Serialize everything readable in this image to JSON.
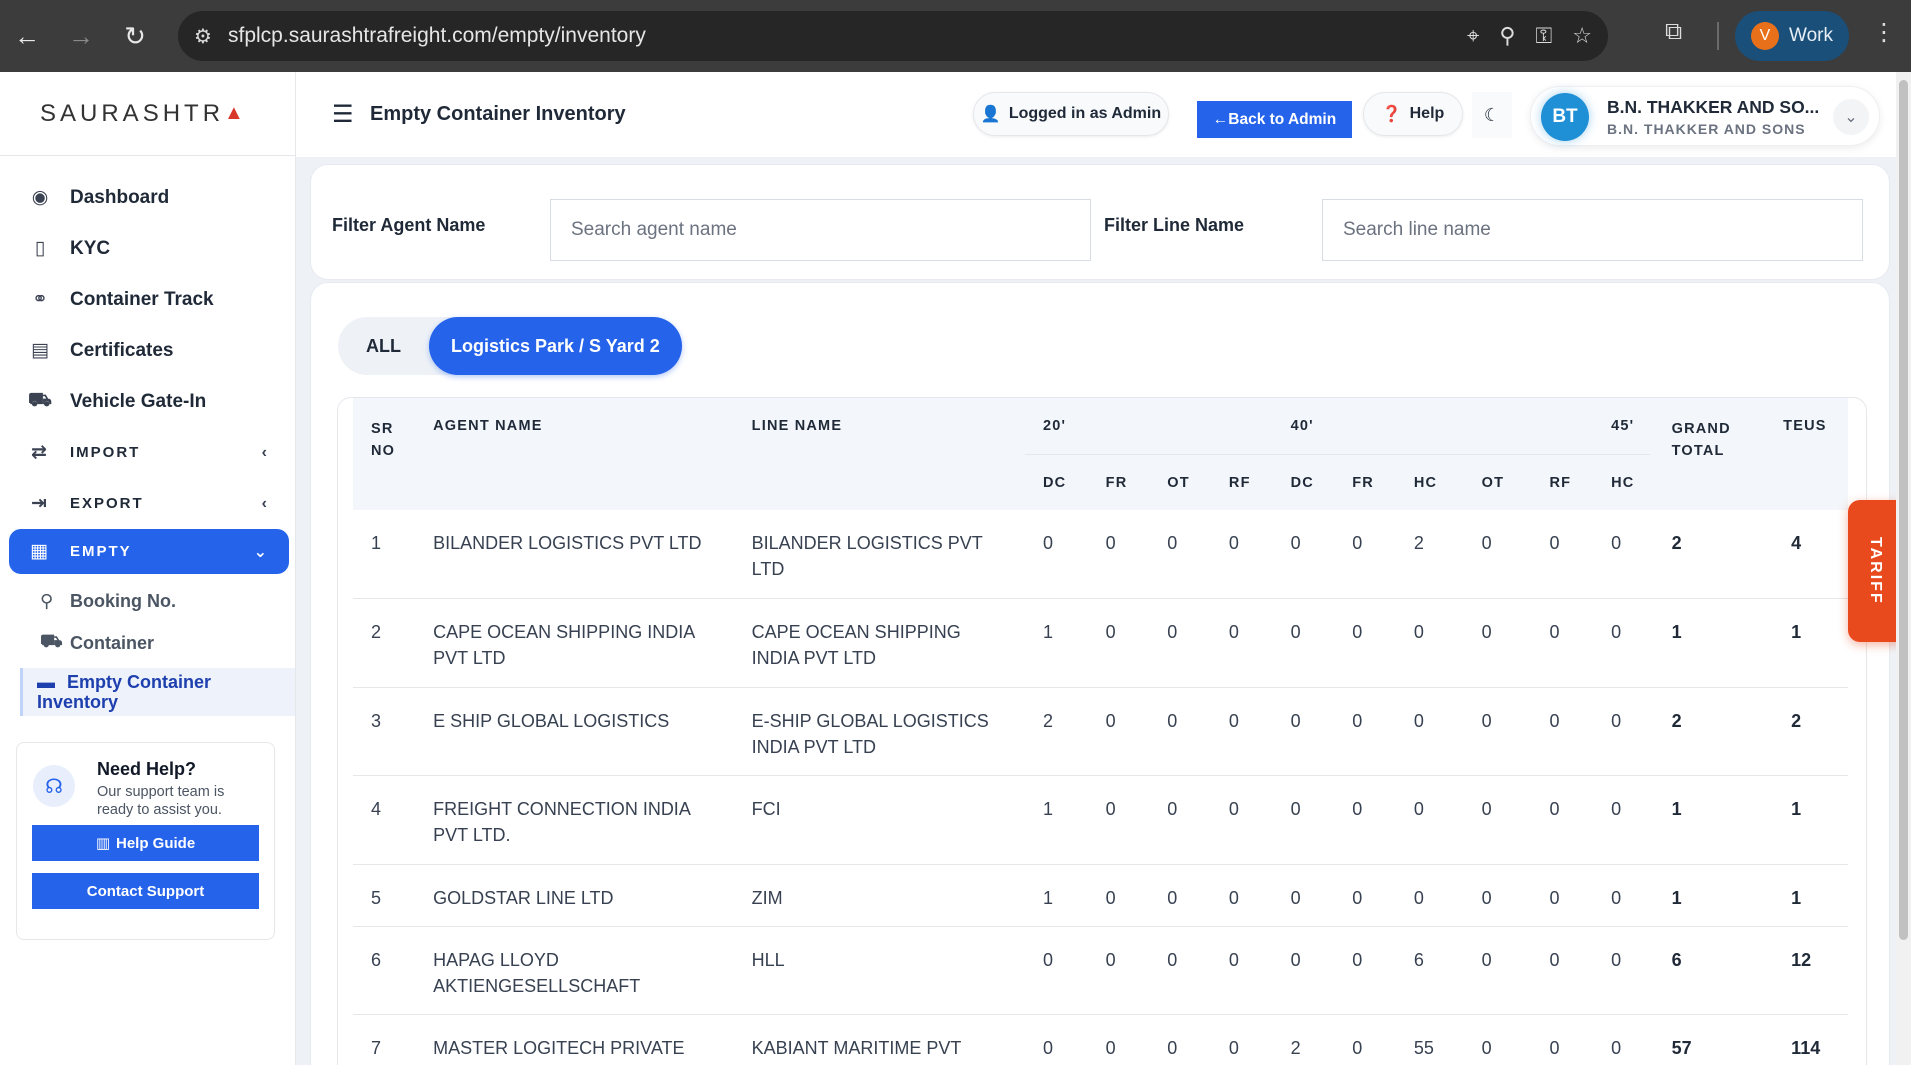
{
  "browser": {
    "url": "sfplcp.saurashtrafreight.com/empty/inventory",
    "profile_initial": "V",
    "profile_label": "Work"
  },
  "sidebar": {
    "logo_text": "SAURASHTR",
    "logo_mark": "▲",
    "items": [
      {
        "label": "Dashboard",
        "icon": "dashboard-icon"
      },
      {
        "label": "KYC",
        "icon": "id-card-icon"
      },
      {
        "label": "Container Track",
        "icon": "track-icon"
      },
      {
        "label": "Certificates",
        "icon": "certificate-icon"
      },
      {
        "label": "Vehicle Gate-In",
        "icon": "truck-icon"
      },
      {
        "label": "IMPORT",
        "icon": "import-icon"
      },
      {
        "label": "EXPORT",
        "icon": "export-icon"
      },
      {
        "label": "EMPTY",
        "icon": "empty-icon"
      }
    ],
    "sub_items": [
      {
        "label": "Booking No.",
        "icon": "search-icon"
      },
      {
        "label": "Container",
        "icon": "truck-icon"
      },
      {
        "label_line1": "Empty Container",
        "label_line2": "Inventory",
        "icon": "briefcase-icon"
      }
    ],
    "help": {
      "title": "Need Help?",
      "desc": "Our support team is ready to assist you.",
      "guide_label": "Help Guide",
      "contact_label": "Contact Support"
    }
  },
  "header": {
    "title": "Empty Container Inventory",
    "logged_in": "Logged in as Admin",
    "back_label": "←Back to Admin",
    "help_label": "Help",
    "user_initials": "BT",
    "user_name": "B.N. THAKKER AND SO...",
    "user_sub": "B.N. THAKKER AND SONS"
  },
  "filters": {
    "agent_label": "Filter Agent Name",
    "agent_placeholder": "Search agent name",
    "agent_value": "",
    "line_label": "Filter Line Name",
    "line_placeholder": "Search line name",
    "line_value": ""
  },
  "tabs": [
    "ALL",
    "Logistics Park / S Yard 2"
  ],
  "table": {
    "headers": {
      "sr_line1": "SR",
      "sr_line2": "NO",
      "agent": "AGENT NAME",
      "line": "LINE NAME",
      "g20": "20'",
      "g40": "40'",
      "g45": "45'",
      "grand_line1": "GRAND",
      "grand_line2": "TOTAL",
      "teus": "TEUS",
      "sub": [
        "DC",
        "FR",
        "OT",
        "RF",
        "DC",
        "FR",
        "HC",
        "OT",
        "RF",
        "HC"
      ]
    },
    "rows": [
      {
        "sr": "1",
        "agent": "BILANDER LOGISTICS PVT LTD",
        "line": "BILANDER LOGISTICS PVT LTD",
        "vals": [
          "0",
          "0",
          "0",
          "0",
          "0",
          "0",
          "2",
          "0",
          "0",
          "0"
        ],
        "total": "2",
        "teus": "4"
      },
      {
        "sr": "2",
        "agent": "CAPE OCEAN SHIPPING INDIA PVT LTD",
        "line": "CAPE OCEAN SHIPPING INDIA PVT LTD",
        "vals": [
          "1",
          "0",
          "0",
          "0",
          "0",
          "0",
          "0",
          "0",
          "0",
          "0"
        ],
        "total": "1",
        "teus": "1"
      },
      {
        "sr": "3",
        "agent": "E SHIP GLOBAL LOGISTICS",
        "line": "E-SHIP GLOBAL LOGISTICS INDIA PVT LTD",
        "vals": [
          "2",
          "0",
          "0",
          "0",
          "0",
          "0",
          "0",
          "0",
          "0",
          "0"
        ],
        "total": "2",
        "teus": "2"
      },
      {
        "sr": "4",
        "agent": "FREIGHT CONNECTION INDIA PVT LTD.",
        "line": "FCI",
        "vals": [
          "1",
          "0",
          "0",
          "0",
          "0",
          "0",
          "0",
          "0",
          "0",
          "0"
        ],
        "total": "1",
        "teus": "1"
      },
      {
        "sr": "5",
        "agent": "GOLDSTAR LINE LTD",
        "line": "ZIM",
        "vals": [
          "1",
          "0",
          "0",
          "0",
          "0",
          "0",
          "0",
          "0",
          "0",
          "0"
        ],
        "total": "1",
        "teus": "1"
      },
      {
        "sr": "6",
        "agent": "HAPAG LLOYD AKTIENGESELLSCHAFT",
        "line": "HLL",
        "vals": [
          "0",
          "0",
          "0",
          "0",
          "0",
          "0",
          "6",
          "0",
          "0",
          "0"
        ],
        "total": "6",
        "teus": "12"
      },
      {
        "sr": "7",
        "agent": "MASTER LOGITECH PRIVATE LIMITED",
        "line": "KABIANT MARITIME PVT LTD",
        "vals": [
          "0",
          "0",
          "0",
          "0",
          "2",
          "0",
          "55",
          "0",
          "0",
          "0"
        ],
        "total": "57",
        "teus": "114"
      }
    ]
  },
  "tariff_label": "TARIFF",
  "colors": {
    "primary": "#2563eb",
    "tariff": "#e8491d",
    "chrome": "#3c3c3c"
  }
}
